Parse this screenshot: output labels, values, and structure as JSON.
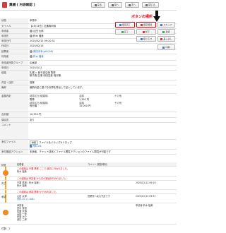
{
  "header": {
    "title": "稟議 [ 内容確認 ]",
    "buttons": [
      "戻る",
      "前へ",
      "次へ",
      "閉じる"
    ]
  },
  "annotation": "ボタンの場所",
  "side_buttons": [
    "保存完了",
    "保存解除",
    "スキップ",
    "完了",
    "却下",
    "承認",
    "取り下げ",
    "差し戻し",
    "印刷"
  ],
  "form": {
    "status_label": "状態",
    "status_value": "申請中",
    "title_label": "タイトル",
    "title_value": "【2月13日】交通費申請",
    "applicant_label": "申請者",
    "applicant_value": "山田 太郎",
    "approver_label": "申請先",
    "approver_value": "鈴木 福美",
    "date_label": "申請日付",
    "date_value": "2025/02/12 09:20:31",
    "created_label": "作成日",
    "created_value": "2025/02/13",
    "author_label": "起票者",
    "author_value": "柴田未来(p6-008)",
    "user_label": "利用者",
    "user_value": "鈴木 福美",
    "group_label": "申請者所属グループ",
    "group_value": "企画部",
    "period_label": "申請日",
    "period_value": "2025/2/12",
    "route_label": "経路",
    "route_value": "札幌 ⇔ 新千歳空港 電車\n新千歳 空港 羽田空港 飛行機",
    "content_label": "内容・目的",
    "content_value": "営業",
    "note_label": "備考",
    "note_value": "最新料金に基づき計算を算出して記入しています。",
    "detail_label": "金額内訳",
    "detail_head": [
      "精算区分(種類順)",
      "金額",
      "その他"
    ],
    "detail_rows": [
      [
        "電車",
        "1,350 円",
        ""
      ],
      [
        "飛行機",
        "15,000 円",
        ""
      ]
    ],
    "total_label": "合計額",
    "total_value": "16,350 円",
    "receipt_label": "領収書",
    "receipt_value": "あり",
    "comment_label": "コメント",
    "attach_label": "添付ファイル",
    "attach_button": "参照",
    "attach_hint": "ファイルをドラッグ&ドロップ",
    "attach_file": "資料.xls",
    "action_label": "添付機能アクション",
    "action_value": "未読者、チャット送信とファイル閲覧アクションのファイル閲覧が可能です"
  },
  "route_table": {
    "headers": [
      "状態",
      "処理者",
      "コメント(発言時刻)",
      ""
    ],
    "rows": [
      {
        "status": "",
        "line1": "この経路は 不要 業務 ここで 最初に行われました。",
        "line2": "鈴木 福美",
        "comment": "",
        "time": ""
      },
      {
        "status": "",
        "line1": "この経路は 申請者 から次の通達が行われました。",
        "line2": "",
        "comment": "",
        "time": ""
      },
      {
        "status": "完了",
        "line1": "不要 業務 ( 鈴木 福美 )",
        "line2": "鈴木 福美",
        "comment": "",
        "time": "2025/02/12 09:16"
      },
      {
        "status": "",
        "line1": "この経路は 承認 業務 か 行われました。",
        "line2": "",
        "comment": "",
        "time": ""
      },
      {
        "status": "承認",
        "line1": "山田 太郎",
        "line2": "資料.xls (1.1KB)",
        "comment": "営業所へ戻る予定です",
        "time": "2025/02/12 09:57"
      },
      {
        "status": "",
        "line1": "承認者",
        "line2": "田中 秀樹\n佐藤 太郎\n高橋 一郎\n伊藤 大介\n渡辺 二郎",
        "comment": "",
        "time": "申請者:鈴木 福美"
      }
    ]
  },
  "footer": "件数：2"
}
